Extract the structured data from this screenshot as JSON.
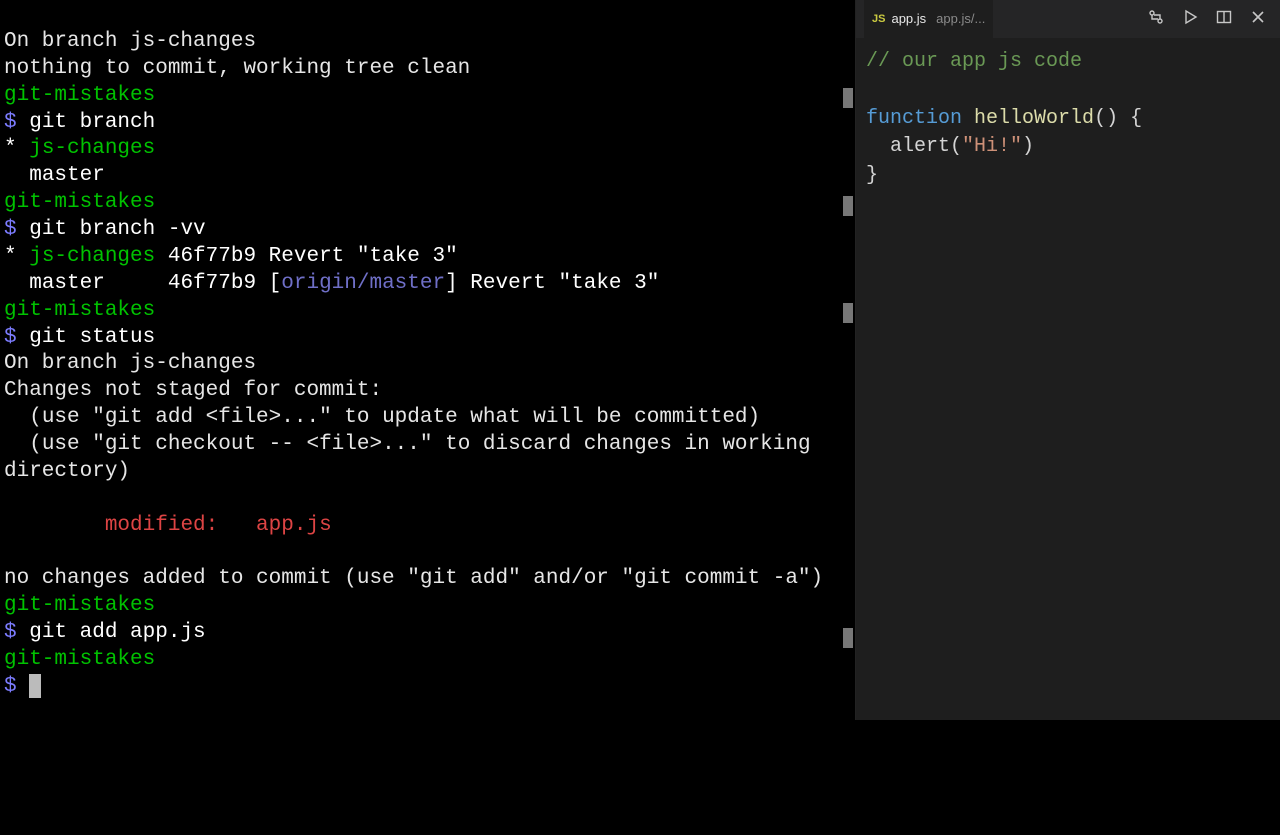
{
  "terminal": {
    "l0": "On branch js-changes",
    "l1": "nothing to commit, working tree clean",
    "dir": "git-mistakes",
    "ps": "$ ",
    "cmd_branch": "git branch",
    "branch_cur": "js-changes",
    "branch_master": "  master",
    "cmd_branch_vv": "git branch -vv",
    "vv_cur": " 46f77b9 Revert \"take 3\"",
    "vv_master_a": "  master     46f77b9 [",
    "vv_master_ref": "origin/master",
    "vv_master_b": "] Revert \"take 3\"",
    "cmd_status": "git status",
    "st0": "On branch js-changes",
    "st1": "Changes not staged for commit:",
    "st2": "  (use \"git add <file>...\" to update what will be committed)",
    "st3": "  (use \"git checkout -- <file>...\" to discard changes in working directory)",
    "st_blank": "",
    "st_mod": "        modified:   app.js",
    "st_tail": "no changes added to commit (use \"git add\" and/or \"git commit -a\")",
    "cmd_add": "git add app.js",
    "star": "* "
  },
  "editor": {
    "tab": {
      "lang": "JS",
      "filename": "app.js",
      "pathHint": "app.js/..."
    },
    "code": {
      "comment": "// our app js code",
      "kw_fn": "function",
      "fn_name": "helloWorld",
      "after_name": "() {",
      "body": "  alert(",
      "str": "\"Hi!\"",
      "body_end": ")",
      "close": "}"
    }
  }
}
